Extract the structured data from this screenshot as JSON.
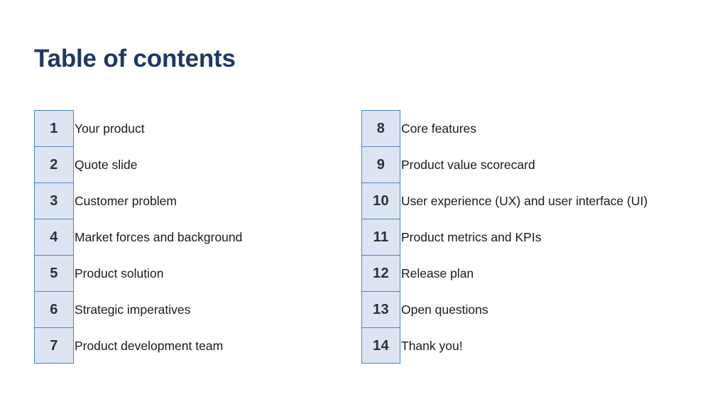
{
  "slide": {
    "title": "Table of contents",
    "background_color": "#ffffff",
    "title_color": "#1f3864",
    "chip_fill_color": "#dde5f2",
    "chip_border_color": "#4a86c8",
    "number_color": "#2f2f38",
    "label_color": "#1a1a1a"
  },
  "toc": {
    "left_column": [
      {
        "number": "1",
        "label": "Your product"
      },
      {
        "number": "2",
        "label": "Quote slide"
      },
      {
        "number": "3",
        "label": "Customer problem"
      },
      {
        "number": "4",
        "label": "Market forces and background"
      },
      {
        "number": "5",
        "label": "Product solution"
      },
      {
        "number": "6",
        "label": "Strategic imperatives"
      },
      {
        "number": "7",
        "label": "Product development team"
      }
    ],
    "right_column": [
      {
        "number": "8",
        "label": "Core features"
      },
      {
        "number": "9",
        "label": "Product value scorecard"
      },
      {
        "number": "10",
        "label": "User experience (UX) and user interface (UI)"
      },
      {
        "number": "11",
        "label": "Product metrics and KPIs"
      },
      {
        "number": "12",
        "label": "Release plan"
      },
      {
        "number": "13",
        "label": "Open questions"
      },
      {
        "number": "14",
        "label": "Thank you!"
      }
    ]
  }
}
